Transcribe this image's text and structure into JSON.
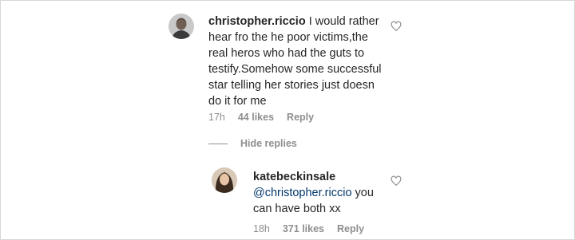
{
  "comments": [
    {
      "username": "christopher.riccio",
      "text": "I would rather hear fro the he poor victims,the real heros who had the guts to testify.Somehow some successful star telling her stories just doesn do it for me",
      "time": "17h",
      "likes": "44 likes",
      "reply_label": "Reply",
      "avatar_icon": "profile-photo-man"
    }
  ],
  "hide_replies_label": "Hide replies",
  "replies": [
    {
      "username": "katebeckinsale",
      "mention": "@christopher.riccio",
      "text": " you can have both xx",
      "time": "18h",
      "likes": "371 likes",
      "reply_label": "Reply",
      "avatar_icon": "profile-photo-woman"
    }
  ],
  "icons": {
    "like": "heart-outline-icon"
  },
  "colors": {
    "text": "#262626",
    "meta": "#8e8e8e",
    "mention": "#00376b",
    "border": "#d6d6d6"
  }
}
